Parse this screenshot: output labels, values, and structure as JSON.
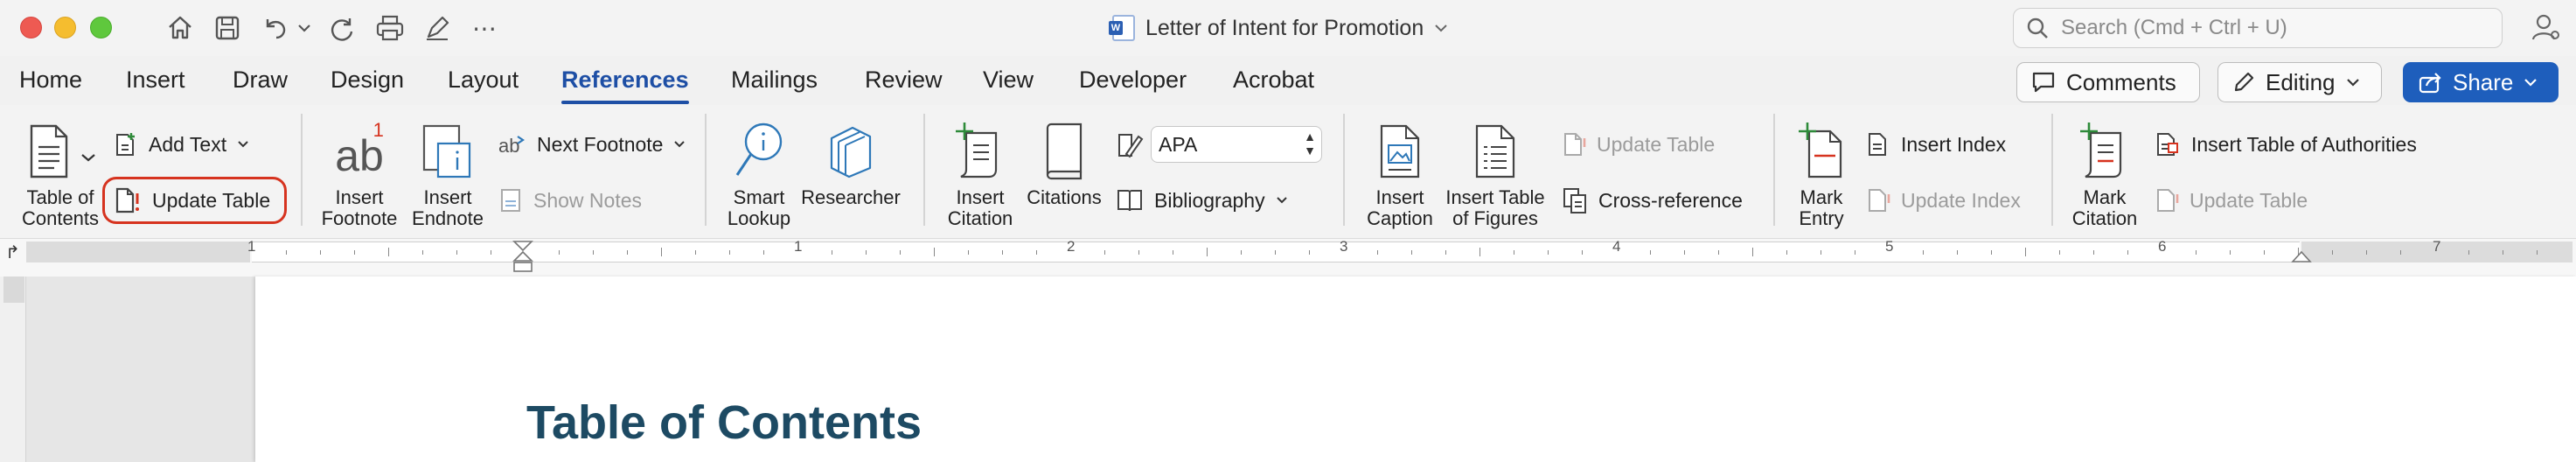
{
  "window": {
    "document_title": "Letter of Intent for Promotion"
  },
  "search": {
    "placeholder": "Search (Cmd + Ctrl + U)"
  },
  "tabs": [
    {
      "label": "Home"
    },
    {
      "label": "Insert"
    },
    {
      "label": "Draw"
    },
    {
      "label": "Design"
    },
    {
      "label": "Layout"
    },
    {
      "label": "References",
      "active": true
    },
    {
      "label": "Mailings"
    },
    {
      "label": "Review"
    },
    {
      "label": "View"
    },
    {
      "label": "Developer"
    },
    {
      "label": "Acrobat"
    }
  ],
  "header_buttons": {
    "comments": "Comments",
    "editing": "Editing",
    "share": "Share"
  },
  "ribbon": {
    "toc": {
      "table_of_contents_line1": "Table of",
      "table_of_contents_line2": "Contents",
      "add_text": "Add Text",
      "update_table": "Update Table"
    },
    "footnotes": {
      "insert_footnote_line1": "Insert",
      "insert_footnote_line2": "Footnote",
      "insert_endnote_line1": "Insert",
      "insert_endnote_line2": "Endnote",
      "next_footnote": "Next Footnote",
      "show_notes": "Show Notes",
      "footnote_badge": "1"
    },
    "research": {
      "smart_lookup_line1": "Smart",
      "smart_lookup_line2": "Lookup",
      "researcher": "Researcher"
    },
    "citations": {
      "insert_citation_line1": "Insert",
      "insert_citation_line2": "Citation",
      "citations": "Citations",
      "style_value": "APA",
      "bibliography": "Bibliography"
    },
    "captions": {
      "insert_caption_line1": "Insert",
      "insert_caption_line2": "Caption",
      "insert_tof_line1": "Insert Table",
      "insert_tof_line2": "of Figures",
      "update_table": "Update Table",
      "cross_reference": "Cross-reference"
    },
    "index": {
      "mark_entry_line1": "Mark",
      "mark_entry_line2": "Entry",
      "insert_index": "Insert Index",
      "update_index": "Update Index"
    },
    "authorities": {
      "mark_citation_line1": "Mark",
      "mark_citation_line2": "Citation",
      "insert_toa": "Insert Table of Authorities",
      "update_table": "Update Table"
    }
  },
  "ruler": {
    "numbers": [
      "1",
      "1",
      "2",
      "3",
      "4",
      "5",
      "6",
      "7"
    ]
  },
  "document": {
    "heading": "Table of Contents"
  },
  "colors": {
    "accent": "#1e4fa5",
    "share": "#1e5ebc",
    "highlight": "#d6331f",
    "heading": "#1d4a63"
  }
}
